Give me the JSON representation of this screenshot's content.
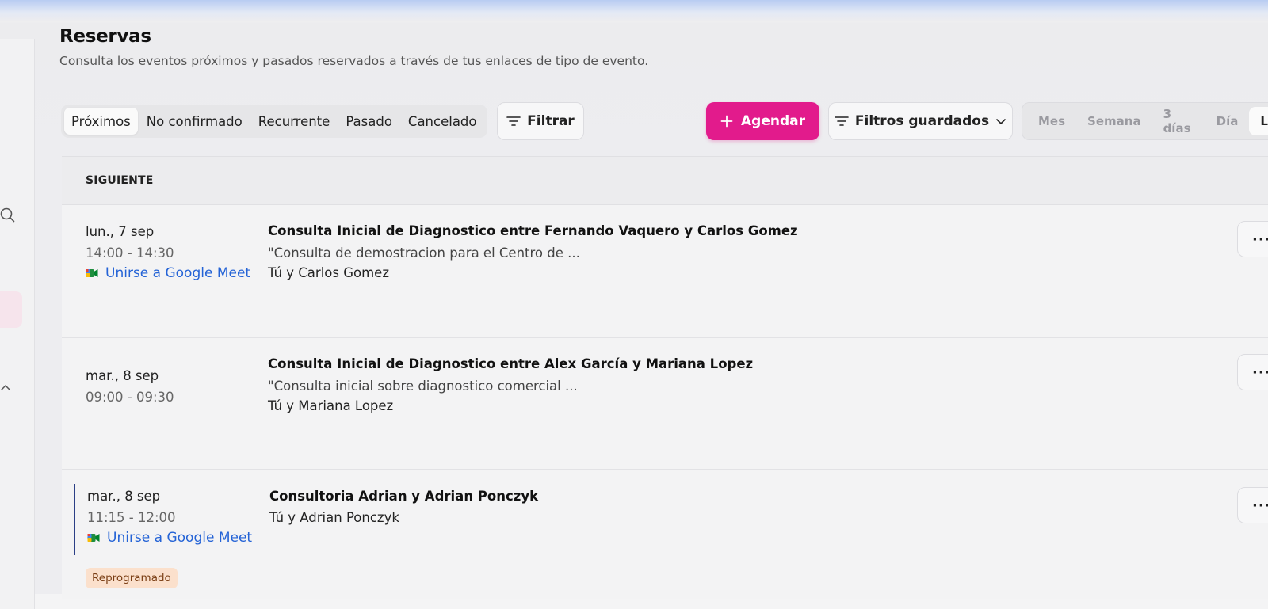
{
  "header": {
    "title": "Reservas",
    "subtitle": "Consulta los eventos próximos y pasados reservados a través de tus enlaces de tipo de evento."
  },
  "tabs": [
    {
      "label": "Próximos",
      "active": true
    },
    {
      "label": "No confirmado",
      "active": false
    },
    {
      "label": "Recurrente",
      "active": false
    },
    {
      "label": "Pasado",
      "active": false
    },
    {
      "label": "Cancelado",
      "active": false
    }
  ],
  "toolbar": {
    "filter_label": "Filtrar",
    "schedule_label": "Agendar",
    "saved_filters_label": "Filtros guardados"
  },
  "views": [
    {
      "label": "Mes",
      "active": false
    },
    {
      "label": "Semana",
      "active": false
    },
    {
      "label": "3 días",
      "active": false
    },
    {
      "label": "Día",
      "active": false
    },
    {
      "label": "Lis",
      "active": true
    }
  ],
  "list": {
    "section_label": "SIGUIENTE",
    "bookings": [
      {
        "date": "lun., 7 sep",
        "time": "14:00 - 14:30",
        "meet_label": "Unirse a Google Meet",
        "title": "Consulta Inicial de Diagnostico entre Fernando Vaquero y Carlos Gomez",
        "description": "\"Consulta de demostracion para el Centro de ...",
        "attendees": "Tú y Carlos Gomez",
        "more": "···"
      },
      {
        "date": "mar., 8 sep",
        "time": "09:00 - 09:30",
        "title": "Consulta Inicial de Diagnostico entre Alex García y Mariana Lopez",
        "description": "\"Consulta inicial sobre diagnostico comercial ...",
        "attendees": "Tú y Mariana Lopez",
        "more": "···"
      },
      {
        "date": "mar., 8 sep",
        "time": "11:15 - 12:00",
        "meet_label": "Unirse a Google Meet",
        "title": "Consultoria Adrian y Adrian Ponczyk",
        "attendees": "Tú y Adrian Ponczyk",
        "badge": "Reprogramado",
        "more": "···"
      }
    ]
  },
  "icons": {
    "search": "search-icon",
    "chevron_up": "chevron-up-icon",
    "filter": "filter-icon",
    "plus": "plus-icon",
    "chevron_down": "chevron-down-icon",
    "meet": "google-meet-icon",
    "more": "more-icon"
  },
  "colors": {
    "accent": "#e21b8c",
    "link": "#2463d6",
    "badge_bg": "#fbe0cc",
    "badge_text": "#7a3e14",
    "rescheduled_bar": "#2b3f86"
  }
}
